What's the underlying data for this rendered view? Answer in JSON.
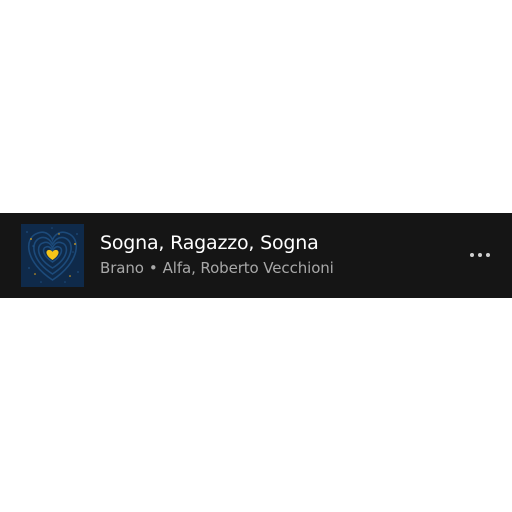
{
  "track": {
    "title": "Sogna, Ragazzo, Sogna",
    "type_label": "Brano",
    "separator": "•",
    "artists": "Alfa, Roberto Vecchioni",
    "artwork_icon": "heart-artwork-icon",
    "more_icon": "more-options-icon"
  },
  "colors": {
    "row_background": "#151515",
    "title": "#ffffff",
    "subtitle": "#a8a8a8",
    "artwork_background": "#0f2a4a",
    "heart": "#f5c518"
  }
}
